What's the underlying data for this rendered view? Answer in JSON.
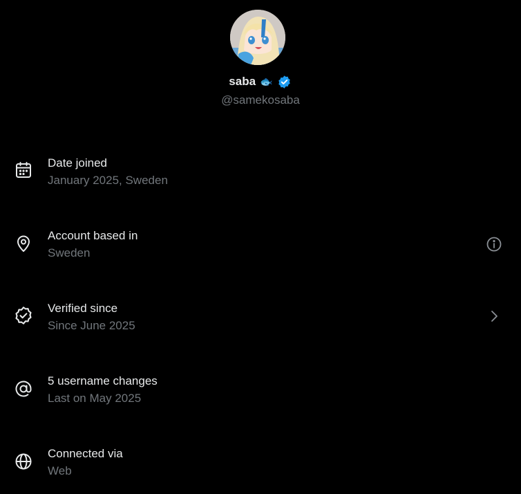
{
  "profile": {
    "display_name": "saba",
    "emoji": "🐟",
    "handle": "@samekosaba",
    "verified": true,
    "avatar_icon": "anime-avatar"
  },
  "colors": {
    "background": "#000000",
    "primary_text": "#e7e9ea",
    "secondary_text": "#71767b",
    "verified_blue": "#1d9bf0"
  },
  "rows": [
    {
      "icon": "calendar-icon",
      "title": "Date joined",
      "subtitle": "January 2025, Sweden",
      "action": null
    },
    {
      "icon": "location-pin-icon",
      "title": "Account based in",
      "subtitle": "Sweden",
      "action": "info-icon"
    },
    {
      "icon": "verified-badge-outline-icon",
      "title": "Verified since",
      "subtitle": "Since June 2025",
      "action": "chevron-right-icon"
    },
    {
      "icon": "at-sign-icon",
      "title": "5 username changes",
      "subtitle": "Last on May 2025",
      "action": null
    },
    {
      "icon": "globe-icon",
      "title": "Connected via",
      "subtitle": "Web",
      "action": null
    }
  ]
}
